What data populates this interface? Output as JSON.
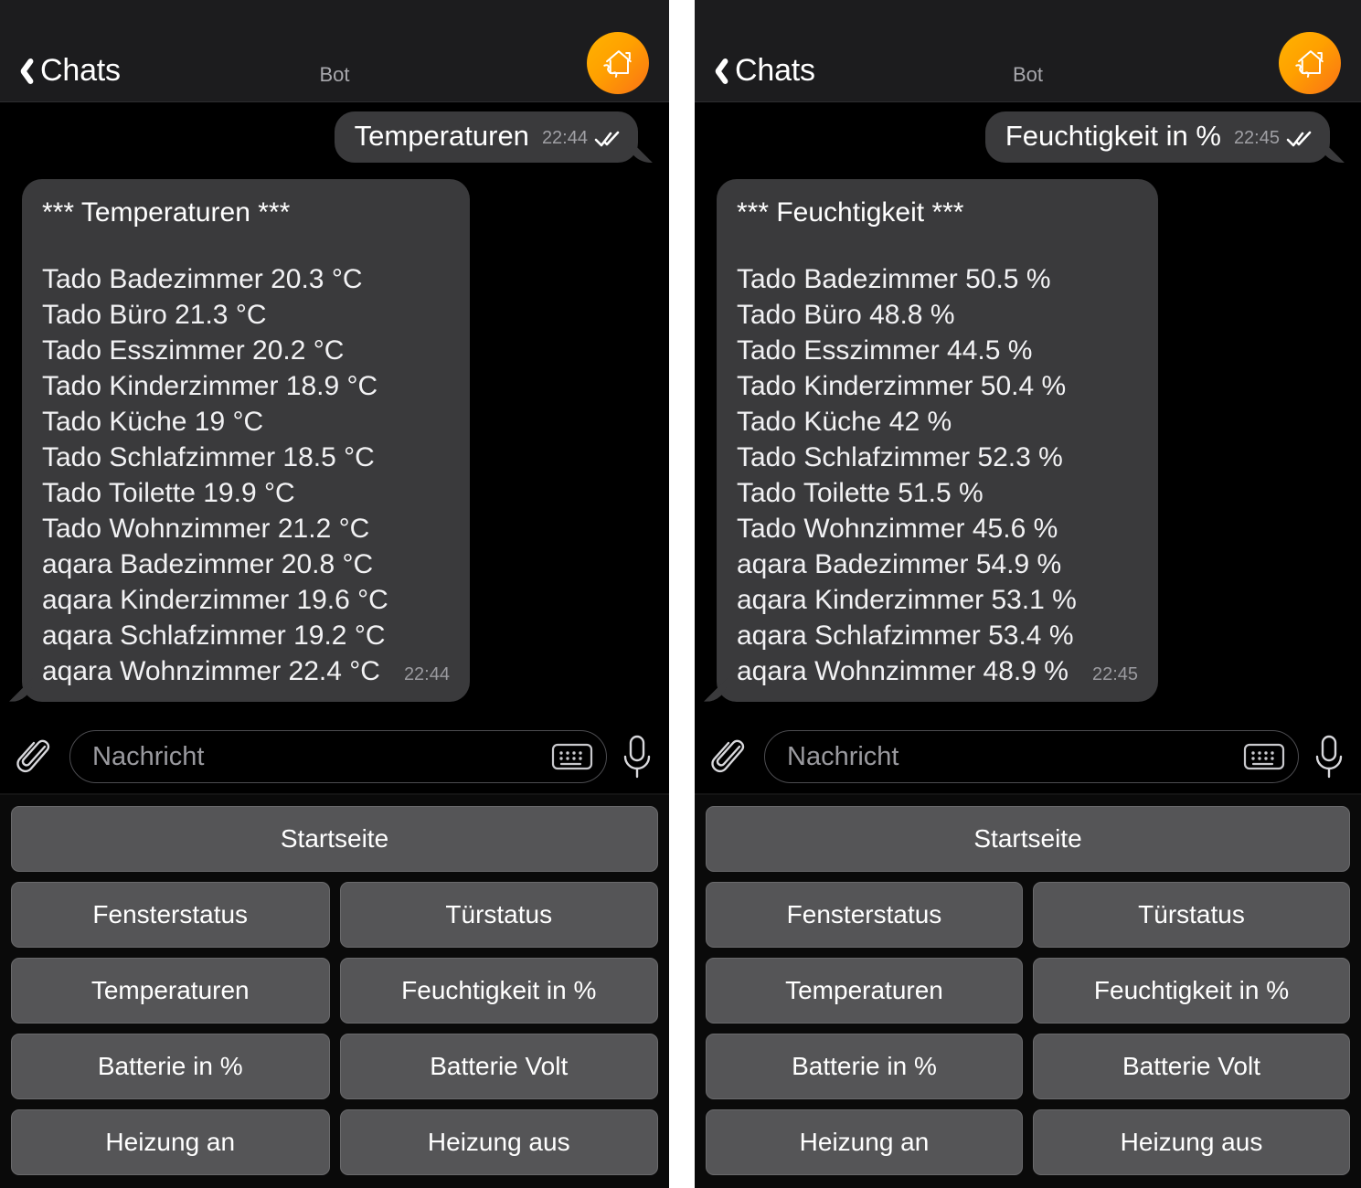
{
  "panels": [
    {
      "header": {
        "back_label": "Chats",
        "title": "Bot",
        "avatar_icon": "home-phone-icon",
        "back_icon": "chevron-left-icon"
      },
      "sent_message": {
        "text": "Temperaturen",
        "time": "22:44",
        "status_icon": "double-check-icon"
      },
      "received_message": {
        "title": "*** Temperaturen ***",
        "lines": [
          "Tado Badezimmer 20.3 °C",
          "Tado Büro 21.3 °C",
          "Tado Esszimmer 20.2 °C",
          "Tado Kinderzimmer 18.9 °C",
          "Tado Küche 19 °C",
          "Tado Schlafzimmer 18.5 °C",
          "Tado Toilette 19.9 °C",
          "Tado Wohnzimmer 21.2 °C",
          "aqara Badezimmer 20.8 °C",
          "aqara Kinderzimmer 19.6 °C",
          "aqara Schlafzimmer 19.2 °C",
          "aqara Wohnzimmer 22.4 °C"
        ],
        "time": "22:44"
      },
      "composer": {
        "attach_icon": "paperclip-icon",
        "placeholder": "Nachricht",
        "value": "",
        "keyboard_icon": "keyboard-icon",
        "mic_icon": "microphone-icon"
      },
      "keyboard": {
        "rows": [
          [
            "Startseite"
          ],
          [
            "Fensterstatus",
            "Türstatus"
          ],
          [
            "Temperaturen",
            "Feuchtigkeit in %"
          ],
          [
            "Batterie in %",
            "Batterie Volt"
          ],
          [
            "Heizung an",
            "Heizung aus"
          ]
        ]
      }
    },
    {
      "header": {
        "back_label": "Chats",
        "title": "Bot",
        "avatar_icon": "home-phone-icon",
        "back_icon": "chevron-left-icon"
      },
      "sent_message": {
        "text": "Feuchtigkeit in %",
        "time": "22:45",
        "status_icon": "double-check-icon"
      },
      "received_message": {
        "title": "*** Feuchtigkeit ***",
        "lines": [
          "Tado Badezimmer 50.5 %",
          "Tado Büro 48.8 %",
          "Tado Esszimmer 44.5 %",
          "Tado Kinderzimmer 50.4 %",
          "Tado Küche 42 %",
          "Tado Schlafzimmer 52.3 %",
          "Tado Toilette 51.5 %",
          "Tado Wohnzimmer 45.6 %",
          "aqara Badezimmer 54.9 %",
          "aqara Kinderzimmer 53.1 %",
          "aqara Schlafzimmer 53.4 %",
          "aqara Wohnzimmer 48.9 %"
        ],
        "time": "22:45"
      },
      "composer": {
        "attach_icon": "paperclip-icon",
        "placeholder": "Nachricht",
        "value": "",
        "keyboard_icon": "keyboard-icon",
        "mic_icon": "microphone-icon"
      },
      "keyboard": {
        "rows": [
          [
            "Startseite"
          ],
          [
            "Fensterstatus",
            "Türstatus"
          ],
          [
            "Temperaturen",
            "Feuchtigkeit in %"
          ],
          [
            "Batterie in %",
            "Batterie Volt"
          ],
          [
            "Heizung an",
            "Heizung aus"
          ]
        ]
      }
    }
  ],
  "colors": {
    "accent": "#ffa000",
    "bubble": "#3a3a3c",
    "header": "#1c1c1e",
    "key": "#555557",
    "background": "#000000"
  }
}
